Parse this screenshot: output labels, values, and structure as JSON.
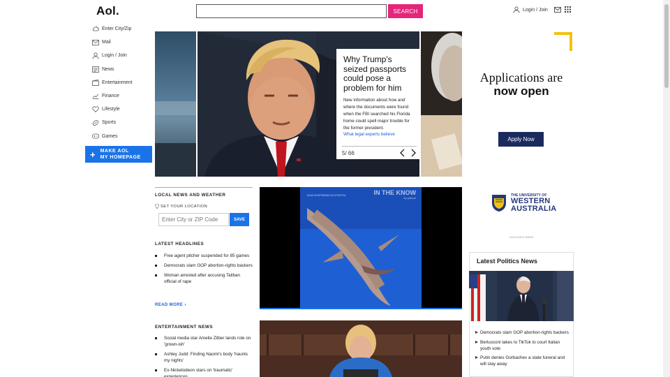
{
  "header": {
    "logo": "Aol.",
    "search_placeholder": "",
    "search_button": "SEARCH",
    "login_label": "Login / Join"
  },
  "nav": {
    "items": [
      {
        "label": "Enter City/Zip",
        "icon": "weather-icon"
      },
      {
        "label": "Mail",
        "icon": "mail-icon"
      },
      {
        "label": "Login / Join",
        "icon": "user-icon"
      },
      {
        "label": "News",
        "icon": "news-icon"
      },
      {
        "label": "Entertainment",
        "icon": "entertainment-icon"
      },
      {
        "label": "Finance",
        "icon": "finance-icon"
      },
      {
        "label": "Lifestyle",
        "icon": "heart-icon"
      },
      {
        "label": "Sports",
        "icon": "sports-icon"
      },
      {
        "label": "Games",
        "icon": "games-icon"
      }
    ],
    "make_homepage_line1": "MAKE AOL",
    "make_homepage_line2": "MY HOMEPAGE"
  },
  "hero": {
    "title": "Why Trump's seized passports could pose a problem for him",
    "description": "New information about how and where the documents were found when the FBI searched his Florida home could spell major trouble for the former president.",
    "link": "What legal experts believe",
    "counter": "5/ 66"
  },
  "ad": {
    "line1": "Applications are",
    "line2": "now open",
    "button": "Apply Now",
    "uni_line1": "THE UNIVERSITY OF",
    "uni_line2": "WESTERN",
    "uni_line3": "AUSTRALIA",
    "unlocked": "UNLOCKED IMAGE"
  },
  "local": {
    "heading": "LOCAL NEWS AND WEATHER",
    "set_location": "SET YOUR LOCATION",
    "zip_placeholder": "Enter City or ZIP Code",
    "save": "SAVE"
  },
  "headlines": {
    "heading": "LATEST HEADLINES",
    "items": [
      "Free agent pitcher suspended for 85 games",
      "Democrats slam GOP abortion-rights backers",
      "Woman arrested after accusing Taliban official of rape"
    ],
    "read_more": "READ MORE ›"
  },
  "entertainment": {
    "heading": "ENTERTAINMENT NEWS",
    "items": [
      "Social media star Amelie Zilber lands role on 'grown-ish'",
      "Ashley Judd: Finding Naomi's body 'haunts my nights'",
      "Ex-Nickelodeon stars on 'traumatic' experiences"
    ]
  },
  "video": {
    "watermark": "IN THE KNOW",
    "watermark_sub": "by yahoo!",
    "credit": "NOAH SHOSTRANDS VIA STORYFUL",
    "progress": 1.0
  },
  "politics": {
    "heading": "Latest Politics News",
    "items": [
      "Democrats slam GOP abortion-rights backers",
      "Berlusconi takes to TikTok to court Italian youth vote",
      "Putin denies Gorbachev a state funeral and will stay away"
    ]
  },
  "colors": {
    "accent_pink": "#e6247a",
    "accent_blue": "#1a73e8",
    "ad_navy": "#1b2a5e",
    "ad_yellow": "#f4c20d"
  }
}
